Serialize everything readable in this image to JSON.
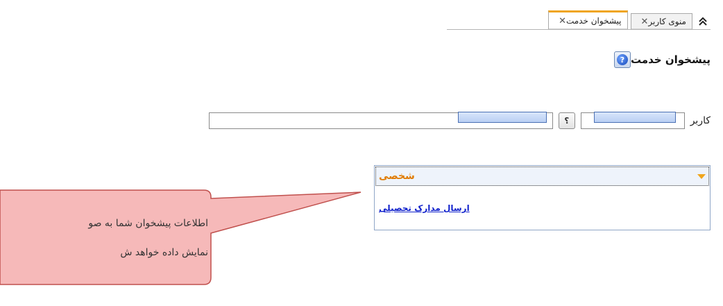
{
  "tabs": [
    {
      "label": "منوی کاربر",
      "active": false
    },
    {
      "label": "پیشخوان خدمت",
      "active": true
    }
  ],
  "page": {
    "title": "پیشخوان خدمت"
  },
  "user_field": {
    "label": "کاربر",
    "code_value": "",
    "name_value": ""
  },
  "service_panel": {
    "category": "شخصی",
    "items": [
      {
        "label": "ارسال مدارک تحصیلی"
      }
    ]
  },
  "callout": {
    "line1": "اطلاعات پیشخوان شما به صو",
    "line2": "نمایش داده خواهد ش"
  },
  "colors": {
    "accent": "#f0a51c",
    "callout_fill": "#f6b9b9",
    "callout_stroke": "#c0504d",
    "link": "#1122cc"
  }
}
